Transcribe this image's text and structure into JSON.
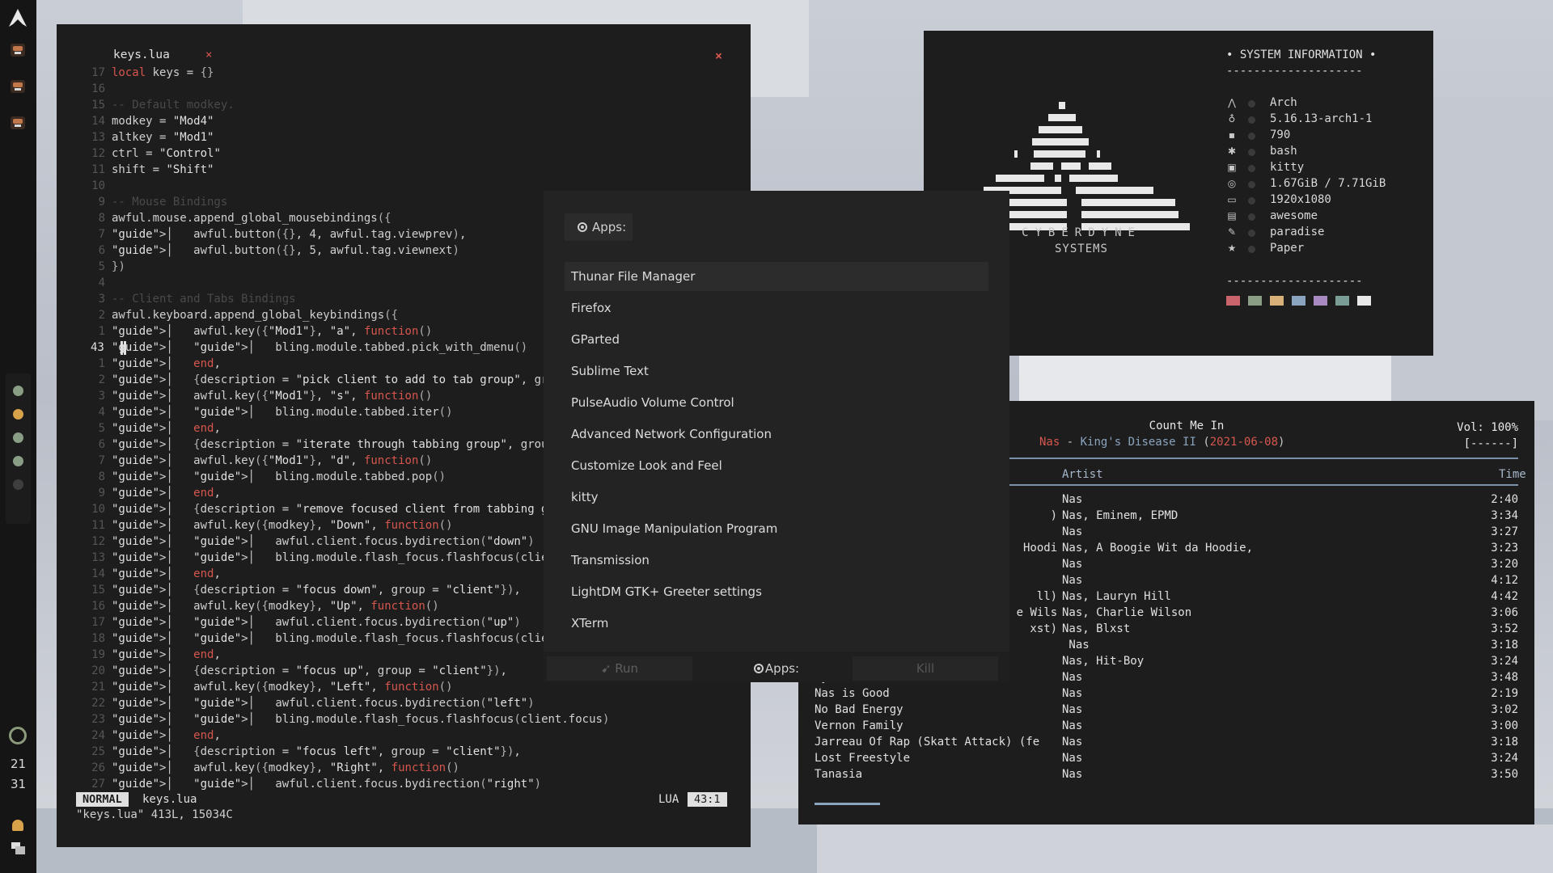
{
  "colors": {
    "accent": "#8aa4bf",
    "red": "#d6564e",
    "string": "#e0e0e0"
  },
  "bar": {
    "time_hour": "21",
    "time_min": "31",
    "tag_colors": [
      "#8a9e86",
      "#d8a24a",
      "#8a9e86",
      "#8a9e86",
      "#3e3e3e"
    ]
  },
  "editor": {
    "tab_name": "keys.lua",
    "tab_close": "×",
    "close": "×",
    "lines": [
      {
        "n": "17",
        "t": "local keys = {}"
      },
      {
        "n": "16",
        "t": ""
      },
      {
        "n": "15",
        "t": "-- Default modkey.",
        "c": true
      },
      {
        "n": "14",
        "t": "modkey = \"Mod4\""
      },
      {
        "n": "13",
        "t": "altkey = \"Mod1\""
      },
      {
        "n": "12",
        "t": "ctrl = \"Control\""
      },
      {
        "n": "11",
        "t": "shift = \"Shift\""
      },
      {
        "n": "10",
        "t": ""
      },
      {
        "n": "9",
        "t": "-- Mouse Bindings",
        "c": true
      },
      {
        "n": "8",
        "t": "awful.mouse.append_global_mousebindings({"
      },
      {
        "n": "7",
        "t": "│   awful.button({}, 4, awful.tag.viewprev),"
      },
      {
        "n": "6",
        "t": "│   awful.button({}, 5, awful.tag.viewnext)"
      },
      {
        "n": "5",
        "t": "})"
      },
      {
        "n": "4",
        "t": ""
      },
      {
        "n": "3",
        "t": "-- Client and Tabs Bindings",
        "c": true
      },
      {
        "n": "2",
        "t": "awful.keyboard.append_global_keybindings({"
      },
      {
        "n": "1",
        "t": "│   awful.key({\"Mod1\"}, \"a\", function()"
      },
      {
        "n": "43",
        "t": "│   │   bling.module.tabbed.pick_with_dmenu()",
        "cur": true
      },
      {
        "n": "1",
        "t": "│   end,"
      },
      {
        "n": "2",
        "t": "│   {description = \"pick client to add to tab group\", group = \"tabs\"}),"
      },
      {
        "n": "3",
        "t": "│   awful.key({\"Mod1\"}, \"s\", function()"
      },
      {
        "n": "4",
        "t": "│   │   bling.module.tabbed.iter()"
      },
      {
        "n": "5",
        "t": "│   end,"
      },
      {
        "n": "6",
        "t": "│   {description = \"iterate through tabbing group\", group = \"tabs\"}),"
      },
      {
        "n": "7",
        "t": "│   awful.key({\"Mod1\"}, \"d\", function()"
      },
      {
        "n": "8",
        "t": "│   │   bling.module.tabbed.pop()"
      },
      {
        "n": "9",
        "t": "│   end,"
      },
      {
        "n": "10",
        "t": "│   {description = \"remove focused client from tabbing group\", group = \"tabs\"}),"
      },
      {
        "n": "11",
        "t": "│   awful.key({modkey}, \"Down\", function()"
      },
      {
        "n": "12",
        "t": "│   │   awful.client.focus.bydirection(\"down\")"
      },
      {
        "n": "13",
        "t": "│   │   bling.module.flash_focus.flashfocus(client.focus)"
      },
      {
        "n": "14",
        "t": "│   end,"
      },
      {
        "n": "15",
        "t": "│   {description = \"focus down\", group = \"client\"}),"
      },
      {
        "n": "16",
        "t": "│   awful.key({modkey}, \"Up\", function()"
      },
      {
        "n": "17",
        "t": "│   │   awful.client.focus.bydirection(\"up\")"
      },
      {
        "n": "18",
        "t": "│   │   bling.module.flash_focus.flashfocus(client.focus)"
      },
      {
        "n": "19",
        "t": "│   end,"
      },
      {
        "n": "20",
        "t": "│   {description = \"focus up\", group = \"client\"}),"
      },
      {
        "n": "21",
        "t": "│   awful.key({modkey}, \"Left\", function()"
      },
      {
        "n": "22",
        "t": "│   │   awful.client.focus.bydirection(\"left\")"
      },
      {
        "n": "23",
        "t": "│   │   bling.module.flash_focus.flashfocus(client.focus)"
      },
      {
        "n": "24",
        "t": "│   end,"
      },
      {
        "n": "25",
        "t": "│   {description = \"focus left\", group = \"client\"}),"
      },
      {
        "n": "26",
        "t": "│   awful.key({modkey}, \"Right\", function()"
      },
      {
        "n": "27",
        "t": "│   │   awful.client.focus.bydirection(\"right\")"
      }
    ],
    "mode": "NORMAL",
    "status_file": "keys.lua",
    "filetype": "LUA",
    "position": "43:1",
    "message": "\"keys.lua\" 413L, 15034C"
  },
  "sysinfo": {
    "header": "• SYSTEM INFORMATION •",
    "dashes": "--------------------",
    "logo_line1": "CYBERDYNE",
    "logo_line2": "SYSTEMS",
    "rows": [
      {
        "icon": "arch-icon",
        "glyph": "⋀",
        "value": "Arch"
      },
      {
        "icon": "kernel-icon",
        "glyph": "♁",
        "value": "5.16.13-arch1-1"
      },
      {
        "icon": "packages-icon",
        "glyph": "▪",
        "value": "790"
      },
      {
        "icon": "shell-icon",
        "glyph": "✱",
        "value": "bash"
      },
      {
        "icon": "terminal-icon",
        "glyph": "▣",
        "value": "kitty"
      },
      {
        "icon": "memory-icon",
        "glyph": "◎",
        "value": "1.67GiB / 7.71GiB"
      },
      {
        "icon": "monitor-icon",
        "glyph": "▭",
        "value": "1920x1080"
      },
      {
        "icon": "wm-icon",
        "glyph": "▤",
        "value": "awesome"
      },
      {
        "icon": "theme-icon",
        "glyph": "✎",
        "value": "paradise"
      },
      {
        "icon": "icons-icon",
        "glyph": "★",
        "value": "Paper"
      }
    ],
    "palette": [
      "#c8646a",
      "#8a9e86",
      "#d8b07a",
      "#8aa4bf",
      "#a98ac0",
      "#7a9e96",
      "#e8e8e8"
    ]
  },
  "music": {
    "title": "Count Me In",
    "artist": "Nas",
    "sep": " - ",
    "album": "King's Disease II",
    "paren_open": " (",
    "date": "2021-06-08",
    "paren_close": ")",
    "volume": "Vol: 100%",
    "volume_bar": "[------]",
    "col_artist": "Artist",
    "col_time": "Time",
    "tracks": [
      {
        "title": "",
        "artist": "Nas",
        "time": "2:40"
      },
      {
        "title": ")",
        "artist": "Nas, Eminem, EPMD",
        "time": "3:34"
      },
      {
        "title": "",
        "artist": "Nas",
        "time": "3:27"
      },
      {
        "title": "Hoodi",
        "artist": "Nas, A Boogie Wit da Hoodie,",
        "time": "3:23"
      },
      {
        "title": "",
        "artist": "Nas",
        "time": "3:20"
      },
      {
        "title": "",
        "artist": "Nas",
        "time": "4:12"
      },
      {
        "title": "ll)",
        "artist": "Nas, Lauryn Hill",
        "time": "4:42"
      },
      {
        "title": "e Wils",
        "artist": "Nas, Charlie Wilson",
        "time": "3:06"
      },
      {
        "title": "xst)",
        "artist": "Nas, Blxst",
        "time": "3:52"
      },
      {
        "title": "",
        "artist": " Nas",
        "time": "3:18"
      },
      {
        "title": "",
        "artist": "Nas, Hit-Boy",
        "time": "3:24"
      },
      {
        "title": "My Bible",
        "artist": "Nas",
        "time": "3:48"
      },
      {
        "title": "Nas is Good",
        "artist": "Nas",
        "time": "2:19"
      },
      {
        "title": "No Bad Energy",
        "artist": "Nas",
        "time": "3:02"
      },
      {
        "title": "Vernon Family",
        "artist": "Nas",
        "time": "3:00"
      },
      {
        "title": "Jarreau Of Rap (Skatt Attack) (fe",
        "artist": "Nas",
        "time": "3:18"
      },
      {
        "title": "Lost Freestyle",
        "artist": "Nas",
        "time": "3:24"
      },
      {
        "title": "Tanasia",
        "artist": "Nas",
        "time": "3:50"
      }
    ]
  },
  "launcher": {
    "prompt": "Apps:",
    "items": [
      "Thunar File Manager",
      "Firefox",
      "GParted",
      "Sublime Text",
      "PulseAudio Volume Control",
      "Advanced Network Configuration",
      "Customize Look and Feel",
      "kitty",
      "GNU Image Manipulation Program",
      "Transmission",
      "LightDM GTK+ Greeter settings",
      "XTerm"
    ],
    "selected_index": 0,
    "mode_run": "Run",
    "mode_apps": "Apps:",
    "mode_kill": "Kill"
  }
}
